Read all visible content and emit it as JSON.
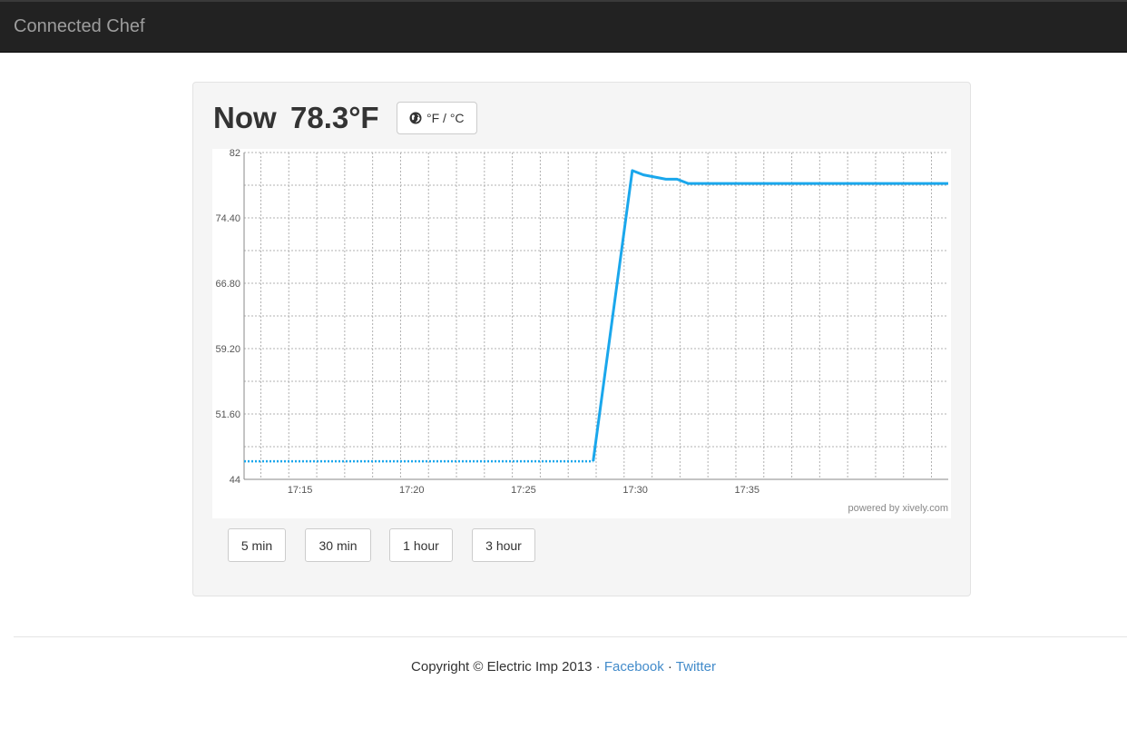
{
  "navbar": {
    "brand": "Connected Chef"
  },
  "reading": {
    "label": "Now",
    "value": "78.3°F"
  },
  "unit_toggle": {
    "label": "°F / °C",
    "icon": "globe-icon"
  },
  "range_buttons": [
    {
      "label": "5 min"
    },
    {
      "label": "30 min"
    },
    {
      "label": "1 hour"
    },
    {
      "label": "3 hour"
    }
  ],
  "chart_data": {
    "type": "line",
    "title": "",
    "xlabel": "",
    "ylabel": "",
    "ylim": [
      44,
      82
    ],
    "y_ticks": [
      "82",
      "74.40",
      "66.80",
      "59.20",
      "51.60",
      "44"
    ],
    "xlim_minutes": [
      "17:12:30",
      "17:44:00"
    ],
    "x_ticks": [
      "17:15",
      "17:20",
      "17:25",
      "17:30",
      "17:35"
    ],
    "grid": true,
    "legend": "none",
    "line_color": "#1aa7ec",
    "credit": "powered by xively.com",
    "series": [
      {
        "style": "dotted",
        "points": [
          {
            "x": "17:12:30",
            "y": 46.1
          },
          {
            "x": "17:28:07",
            "y": 46.1
          }
        ]
      },
      {
        "style": "solid",
        "points": [
          {
            "x": "17:28:07",
            "y": 46.1
          },
          {
            "x": "17:29:52",
            "y": 79.9
          },
          {
            "x": "17:30:22",
            "y": 79.4
          },
          {
            "x": "17:31:22",
            "y": 78.9
          },
          {
            "x": "17:31:52",
            "y": 78.9
          },
          {
            "x": "17:32:22",
            "y": 78.4
          },
          {
            "x": "17:44:00",
            "y": 78.4
          }
        ]
      }
    ]
  },
  "footer": {
    "copyright": "Copyright © Electric Imp 2013 · ",
    "facebook": "Facebook",
    "separator": " · ",
    "twitter": "Twitter"
  }
}
